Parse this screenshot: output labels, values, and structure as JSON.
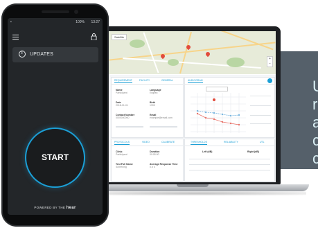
{
  "side_text": [
    "U",
    "r",
    "a",
    "c",
    "c"
  ],
  "phone": {
    "status_time": "13:27",
    "status_battery": "100%",
    "updates_label": "UPDATES",
    "start_label": "START",
    "powered_prefix": "POWERED BY THE",
    "powered_brand": "hear"
  },
  "laptop": {
    "map_tab": "Satellite",
    "left_tabs": [
      "REQUIREMENT",
      "FACILITY",
      "GENERAL"
    ],
    "right_tabs": [
      "AUDIOGRAM"
    ],
    "bottom_left_tabs": [
      "PROTOCOLS",
      "VIDEO",
      "CALIBRATE"
    ],
    "bottom_right_tabs": [
      "THRESHOLDS",
      "RELIABILITY",
      "UTL"
    ],
    "fields": [
      {
        "k": "Name",
        "v": "Participant"
      },
      {
        "k": "Language",
        "v": "English"
      },
      {
        "k": "Date",
        "v": "2018-01-01"
      },
      {
        "k": "Birth",
        "v": "1990"
      },
      {
        "k": "Contact Number",
        "v": "0000000000"
      },
      {
        "k": "Email",
        "v": "example@email.com"
      }
    ],
    "bottom_fields": [
      {
        "k": "Clinic",
        "v": "Participant"
      },
      {
        "k": "Duration",
        "v": "00:05:00"
      },
      {
        "k": "Test Full Name",
        "v": "Screening"
      },
      {
        "k": "Average Response Time",
        "v": "0.5 s"
      }
    ],
    "table_cols": [
      "Left (dB)",
      "Right (dB)"
    ]
  },
  "colors": {
    "accent": "#1b9fd6",
    "phone_bg": "#232629",
    "panel": "#55606a"
  }
}
